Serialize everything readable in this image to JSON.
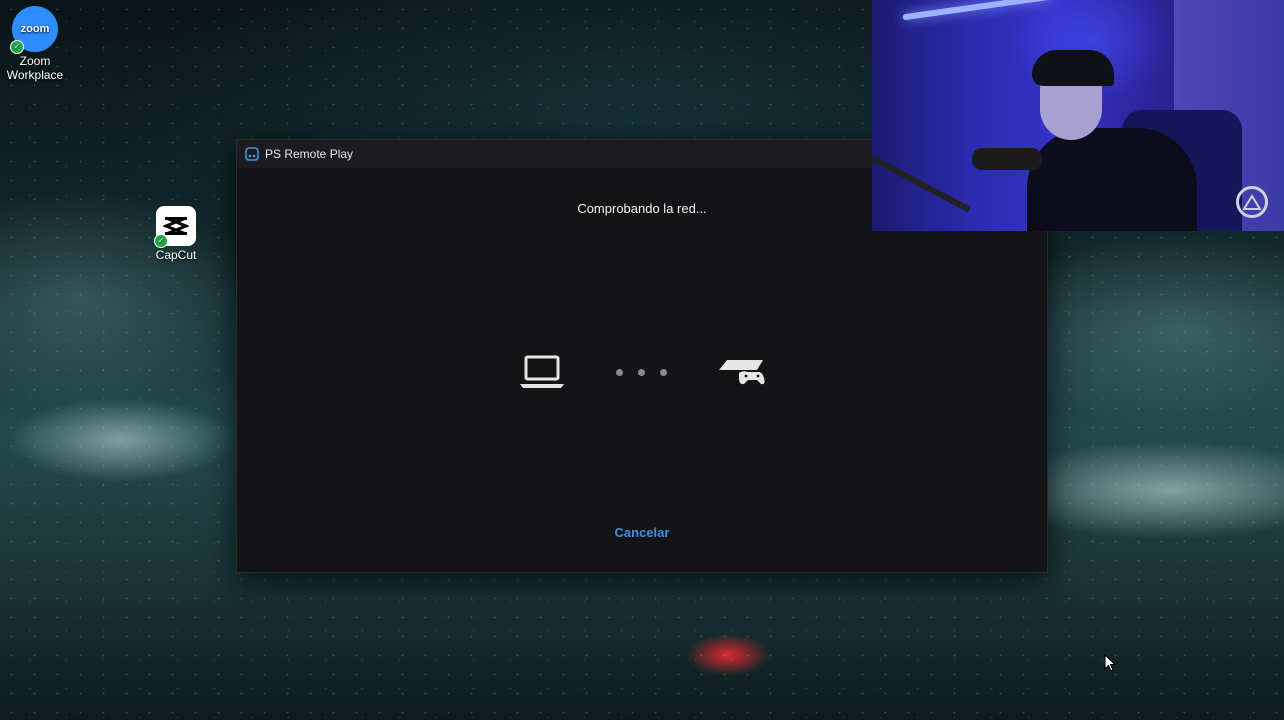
{
  "desktop": {
    "icons": [
      {
        "label_line1": "Zoom",
        "label_line2": "Workplace",
        "tile_text": "zoom",
        "icon": "zoom-icon"
      },
      {
        "label_line1": "CapCut",
        "icon": "capcut-icon"
      }
    ]
  },
  "window": {
    "title": "PS Remote Play",
    "status": "Comprobando la red...",
    "cancel_label": "Cancelar",
    "source_icon": "laptop-icon",
    "target_icon": "ps-console-icon"
  },
  "colors": {
    "accent_link": "#3d8fe0",
    "window_bg": "#141417",
    "zoom_blue": "#2d8cff"
  }
}
